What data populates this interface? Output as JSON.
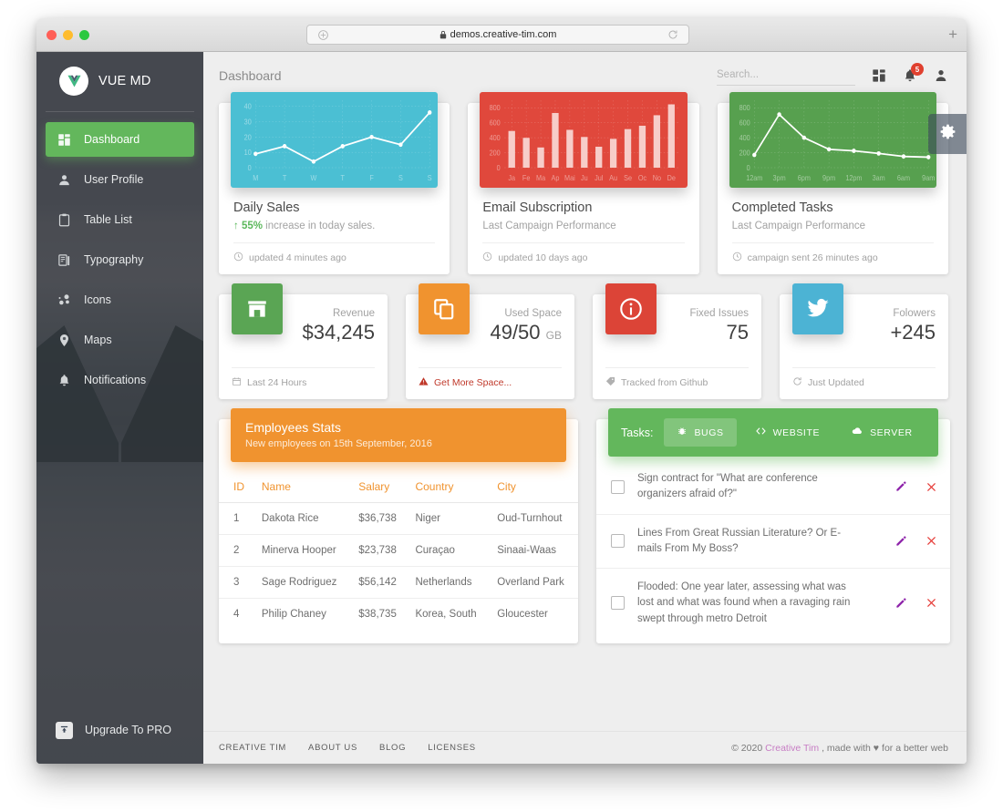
{
  "browser": {
    "url": "demos.creative-tim.com",
    "lock_icon": "lock-icon",
    "reload_icon": "reload-icon",
    "sidebar_toggle_icon": "sidebar-toggle-icon",
    "newtab_label": "+"
  },
  "sidebar": {
    "brand": "VUE MD",
    "items": [
      {
        "label": "Dashboard",
        "icon": "dashboard-icon",
        "active": true
      },
      {
        "label": "User Profile",
        "icon": "user-icon",
        "active": false
      },
      {
        "label": "Table List",
        "icon": "clipboard-icon",
        "active": false
      },
      {
        "label": "Typography",
        "icon": "typography-icon",
        "active": false
      },
      {
        "label": "Icons",
        "icon": "bubbles-icon",
        "active": false
      },
      {
        "label": "Maps",
        "icon": "map-pin-icon",
        "active": false
      },
      {
        "label": "Notifications",
        "icon": "bell-icon",
        "active": false
      }
    ],
    "upgrade": {
      "label": "Upgrade To PRO",
      "icon": "unarchive-icon"
    }
  },
  "header": {
    "title": "Dashboard",
    "search_placeholder": "Search...",
    "search_value": "",
    "apps_icon": "apps-grid-icon",
    "notifications_icon": "bell-icon",
    "notifications_count": "5",
    "person_icon": "person-icon",
    "settings_icon": "gear-icon"
  },
  "colors": {
    "green": "#63b75c",
    "orange": "#f0932f",
    "red": "#e0483c",
    "cyan": "#4bbfd3",
    "dark_red": "#dc4437",
    "twitter_blue": "#4cb3d4",
    "sidebar": "#3c4858",
    "accent_pink": "#c77dc4"
  },
  "chart_cards": [
    {
      "title": "Daily Sales",
      "subtitle_prefix": "55%",
      "subtitle": " increase in today sales.",
      "subtitle_accent": true,
      "footer": "updated 4 minutes ago",
      "footer_icon": "clock-icon"
    },
    {
      "title": "Email Subscription",
      "subtitle": "Last Campaign Performance",
      "subtitle_accent": false,
      "footer": "updated 10 days ago",
      "footer_icon": "clock-icon"
    },
    {
      "title": "Completed Tasks",
      "subtitle": "Last Campaign Performance",
      "subtitle_accent": false,
      "footer": "campaign sent 26 minutes ago",
      "footer_icon": "clock-icon"
    }
  ],
  "chart_data": [
    {
      "type": "line",
      "title": "Daily Sales",
      "categories": [
        "M",
        "T",
        "W",
        "T",
        "F",
        "S",
        "S"
      ],
      "values": [
        9,
        14,
        4,
        14,
        20,
        15,
        36
      ],
      "yticks": [
        0,
        10,
        20,
        30,
        40
      ],
      "ylim": [
        0,
        44
      ],
      "xlabel": "",
      "ylabel": "",
      "grid": true,
      "legend": "none",
      "bg_color": "#4bbfd3",
      "series_color": "#ffffff"
    },
    {
      "type": "bar",
      "title": "Email Subscription",
      "categories": [
        "Ja",
        "Fe",
        "Ma",
        "Ap",
        "Mai",
        "Ju",
        "Jul",
        "Au",
        "Se",
        "Oc",
        "No",
        "De"
      ],
      "values": [
        490,
        398,
        270,
        730,
        505,
        410,
        280,
        385,
        515,
        560,
        700,
        845
      ],
      "yticks": [
        0,
        200,
        400,
        600,
        800
      ],
      "ylim": [
        0,
        900
      ],
      "xlabel": "",
      "ylabel": "",
      "grid": true,
      "legend": "none",
      "bg_color": "#e0483c",
      "series_color": "#f7cdc9"
    },
    {
      "type": "line",
      "title": "Completed Tasks",
      "categories": [
        "12am",
        "3pm",
        "6pm",
        "9pm",
        "12pm",
        "3am",
        "6am",
        "9am"
      ],
      "values": [
        170,
        710,
        400,
        245,
        225,
        190,
        150,
        140
      ],
      "yticks": [
        0,
        200,
        400,
        600,
        800
      ],
      "ylim": [
        0,
        900
      ],
      "xlabel": "",
      "ylabel": "",
      "grid": true,
      "legend": "none",
      "bg_color": "#57a04f",
      "series_color": "#ffffff"
    }
  ],
  "stats": [
    {
      "label": "Revenue",
      "value": "$34,245",
      "unit": "",
      "icon": "store-icon",
      "icon_color": "#5aa554",
      "footer": "Last 24 Hours",
      "footer_icon": "calendar-icon",
      "footer_danger": false
    },
    {
      "label": "Used Space",
      "value": "49/50",
      "unit": "GB",
      "icon": "copy-icon",
      "icon_color": "#f0932f",
      "footer": "Get More Space...",
      "footer_icon": "warning-icon",
      "footer_danger": true
    },
    {
      "label": "Fixed Issues",
      "value": "75",
      "unit": "",
      "icon": "info-icon",
      "icon_color": "#dc4437",
      "footer": "Tracked from Github",
      "footer_icon": "tag-icon",
      "footer_danger": false
    },
    {
      "label": "Folowers",
      "value": "+245",
      "unit": "",
      "icon": "twitter-icon",
      "icon_color": "#4cb3d4",
      "footer": "Just Updated",
      "footer_icon": "refresh-icon",
      "footer_danger": false
    }
  ],
  "employees": {
    "title": "Employees Stats",
    "subtitle": "New employees on 15th September, 2016",
    "columns": [
      "ID",
      "Name",
      "Salary",
      "Country",
      "City"
    ],
    "rows": [
      [
        "1",
        "Dakota Rice",
        "$36,738",
        "Niger",
        "Oud-Turnhout"
      ],
      [
        "2",
        "Minerva Hooper",
        "$23,738",
        "Curaçao",
        "Sinaai-Waas"
      ],
      [
        "3",
        "Sage Rodriguez",
        "$56,142",
        "Netherlands",
        "Overland Park"
      ],
      [
        "4",
        "Philip Chaney",
        "$38,735",
        "Korea, South",
        "Gloucester"
      ]
    ]
  },
  "tasks": {
    "label": "Tasks:",
    "tabs": [
      {
        "label": "BUGS",
        "icon": "bug-icon",
        "active": true
      },
      {
        "label": "WEBSITE",
        "icon": "code-icon",
        "active": false
      },
      {
        "label": "SERVER",
        "icon": "cloud-icon",
        "active": false
      }
    ],
    "items": [
      {
        "text": "Sign contract for \"What are conference organizers afraid of?\"",
        "checked": false,
        "edit_icon": "pencil-icon",
        "delete_icon": "close-icon"
      },
      {
        "text": "Lines From Great Russian Literature? Or E-mails From My Boss?",
        "checked": false,
        "edit_icon": "pencil-icon",
        "delete_icon": "close-icon"
      },
      {
        "text": "Flooded: One year later, assessing what was lost and what was found when a ravaging rain swept through metro Detroit",
        "checked": false,
        "edit_icon": "pencil-icon",
        "delete_icon": "close-icon"
      }
    ]
  },
  "footer": {
    "links": [
      "CREATIVE TIM",
      "ABOUT US",
      "BLOG",
      "LICENSES"
    ],
    "copyright_prefix": "© 2020 ",
    "brand": "Creative Tim",
    "copyright_mid": ", made with ",
    "heart": "♥",
    "copyright_suffix": " for a better web"
  }
}
